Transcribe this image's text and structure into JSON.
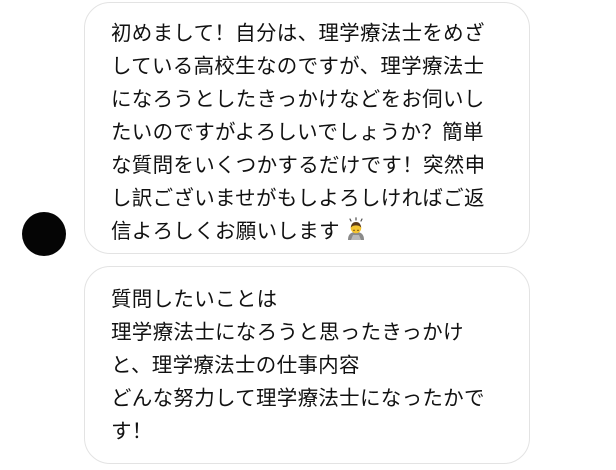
{
  "conversation": {
    "messages": [
      {
        "lines": [
          "初めまして！自分は、理学療法士をめざ",
          "している高校生なのですが、理学療法士",
          "になろうとしたきっかけなどをお伺いし",
          "たいのですがよろしいでしょうか？簡単",
          "な質問をいくつかするだけです！突然申",
          "し訳ございませがもしよろしければご返",
          "信よろしくお願いします"
        ],
        "emoji": "bowing-person-emoji"
      },
      {
        "lines": [
          "質問したいことは",
          "理学療法士になろうと思ったきっかけ",
          "と、理学療法士の仕事内容",
          "どんな努力して理学療法士になったかで",
          "す！"
        ]
      }
    ]
  },
  "colors": {
    "bubble_border": "#e3e3e3",
    "avatar": "#050505",
    "text": "#111111"
  }
}
